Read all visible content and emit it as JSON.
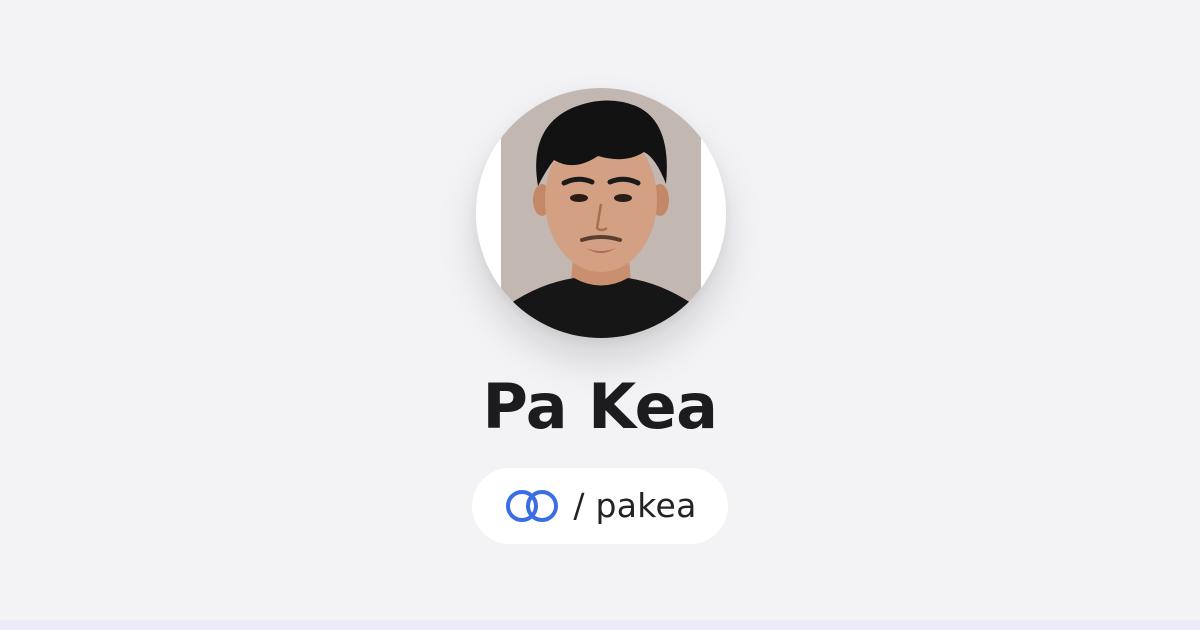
{
  "profile": {
    "name": "Pa Kea",
    "handle": "/ pakea",
    "avatar": "profile-photo"
  },
  "brand": {
    "logo": "linked-rings-icon",
    "accent": "#3b6ee6"
  }
}
